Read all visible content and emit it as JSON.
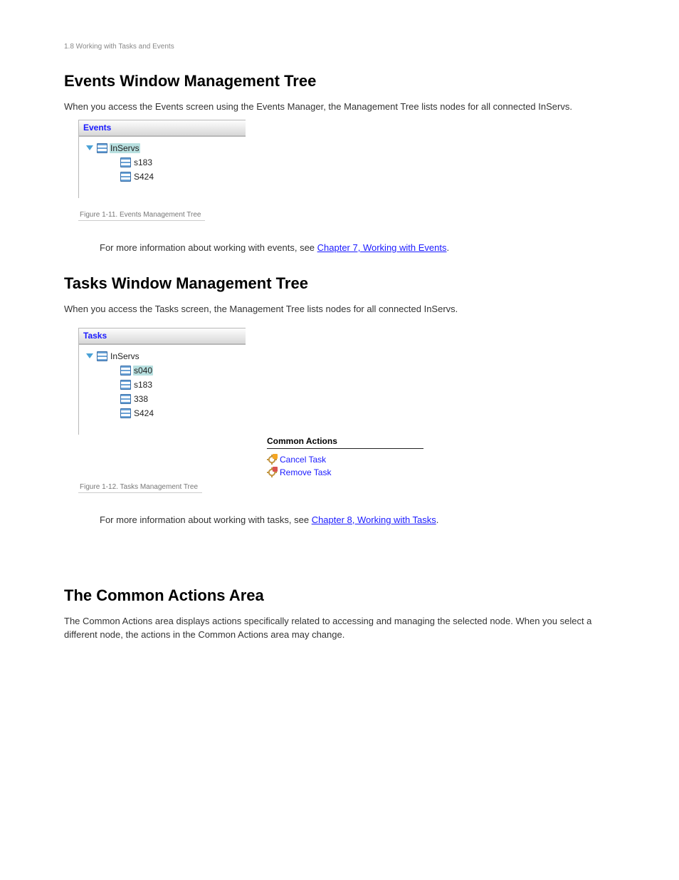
{
  "runhead": "1.8 Working with Tasks and Events",
  "events": {
    "section_title": "Events Window Management Tree",
    "intro": "When you access the Events screen using the Events Manager, the Management Tree lists nodes for all connected InServs.",
    "panel_title": "Events",
    "root": "InServs",
    "children": [
      "s183",
      "S424"
    ],
    "caption": "Figure 1-11.  Events Management Tree",
    "more_pre": "For more information about working with events, see ",
    "more_link": "Chapter 7, Working with Events",
    "more_post": "."
  },
  "tasks": {
    "section_title": "Tasks Window Management Tree",
    "intro": "When you access the Tasks screen, the Management Tree lists nodes for all connected InServs.",
    "panel_title": "Tasks",
    "root": "InServs",
    "children": [
      "s040",
      "s183",
      "338",
      "S424"
    ],
    "selected": "s040",
    "caption": "Figure 1-12.  Tasks Management Tree",
    "more_pre": "For more information about working with tasks, see ",
    "more_link": "Chapter 8, Working with Tasks",
    "more_post": ".",
    "actions_heading": "Common Actions"
  },
  "actions_section": {
    "heading": "Common Actions",
    "items": [
      {
        "name": "cancel-task",
        "label": "Cancel Task",
        "badge": "warn"
      },
      {
        "name": "remove-task",
        "label": "Remove Task",
        "badge": "del"
      }
    ]
  },
  "common_actions_block": {
    "heading": "The Common Actions Area",
    "body": "The Common Actions area displays actions specifically related to accessing and managing the selected node. When you select a different node, the actions in the Common Actions area may change."
  }
}
